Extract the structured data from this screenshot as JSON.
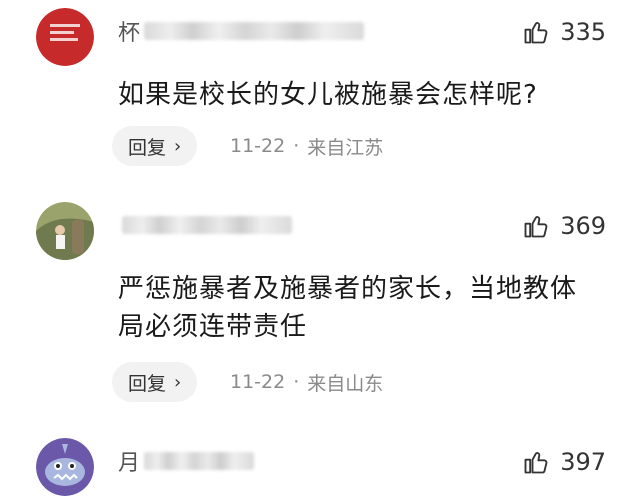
{
  "comments": [
    {
      "username_visible": "杯",
      "likes": "335",
      "text_lines": [
        "如果是校长的女儿被施暴会怎样呢?"
      ],
      "reply_label": "回复",
      "date": "11-22",
      "location": "来自江苏",
      "avatar_color": "#c62a2a"
    },
    {
      "username_visible": "",
      "likes": "369",
      "text_lines": [
        "严惩施暴者及施暴者的家长，当地教体",
        "局必须连带责任"
      ],
      "reply_label": "回复",
      "date": "11-22",
      "location": "来自山东",
      "avatar_color": "#6f7b4f"
    },
    {
      "username_visible": "月",
      "likes": "397",
      "text_lines": [],
      "reply_label": "",
      "date": "",
      "location": "",
      "avatar_color": "#6b58a8"
    }
  ],
  "icons": {
    "like": "thumbs-up-icon",
    "reply_chevron": "chevron-right-icon"
  }
}
